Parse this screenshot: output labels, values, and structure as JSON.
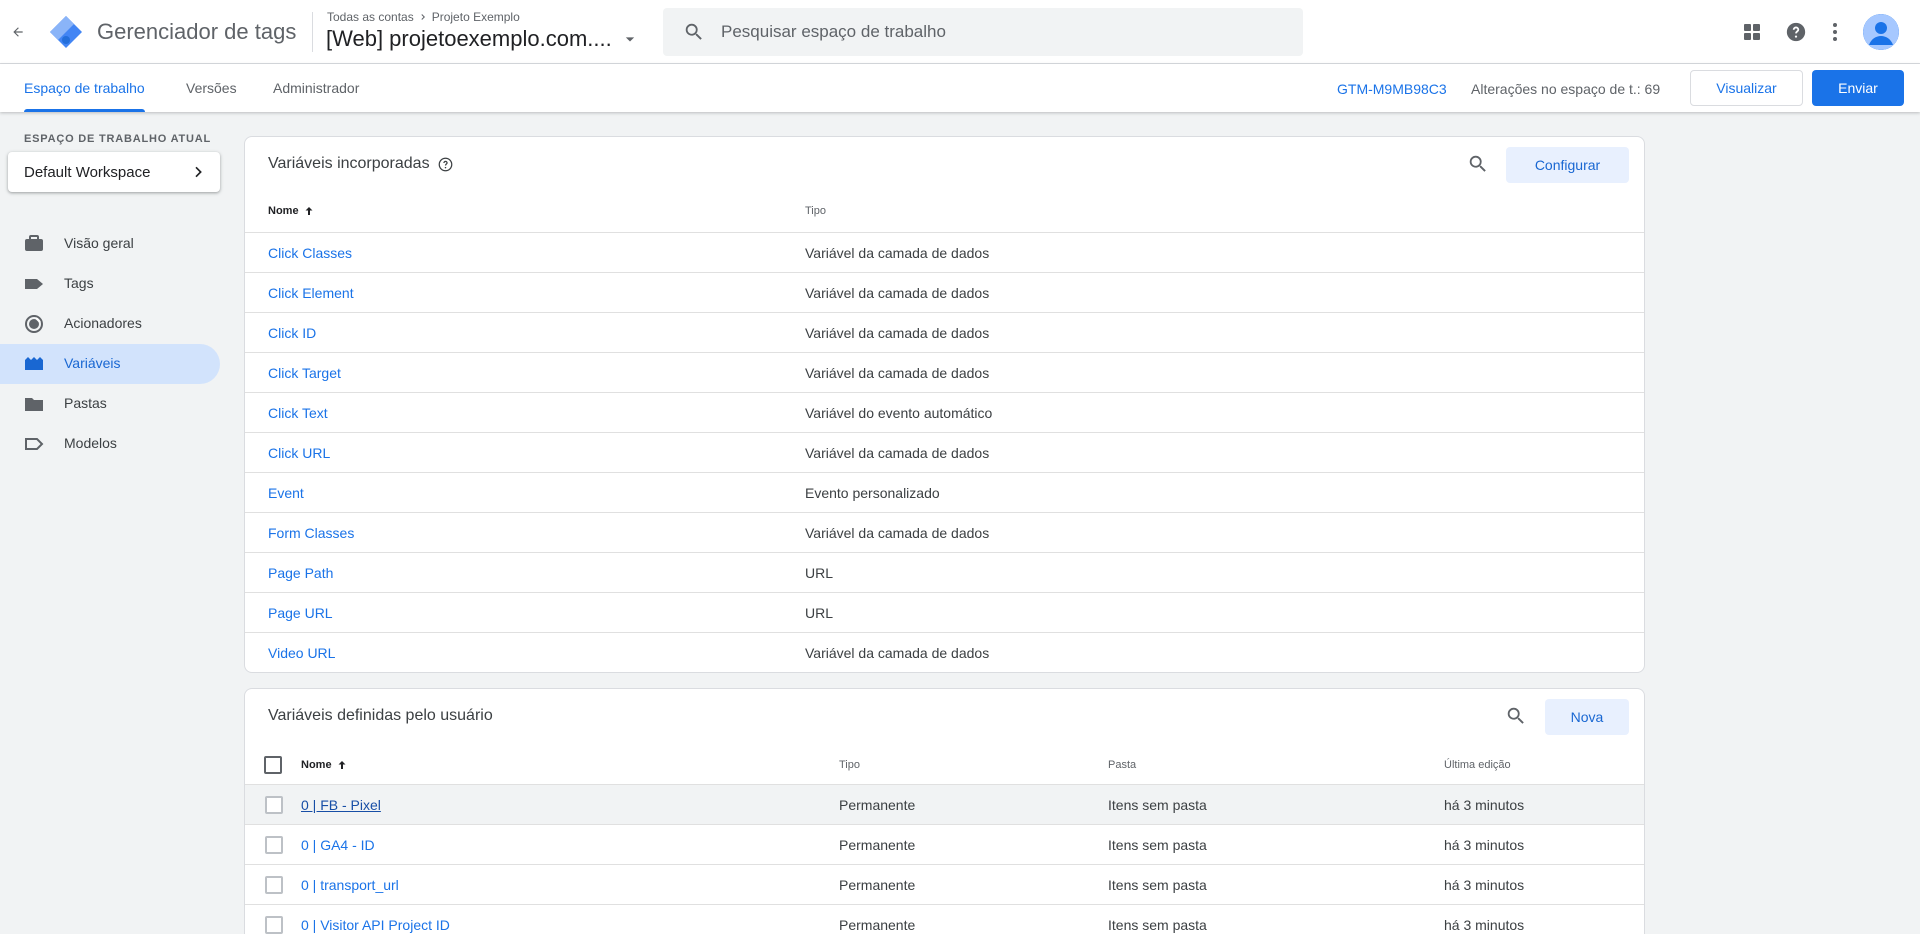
{
  "header": {
    "app_title": "Gerenciador de tags",
    "breadcrumb_account": "Todas as contas",
    "breadcrumb_project": "Projeto Exemplo",
    "container_name": "[Web] projetoexemplo.com....",
    "search_placeholder": "Pesquisar espaço de trabalho"
  },
  "subnav": {
    "tabs": [
      {
        "label": "Espaço de trabalho"
      },
      {
        "label": "Versões"
      },
      {
        "label": "Administrador"
      }
    ],
    "gtm_id": "GTM-M9MB98C3",
    "changes_label": "Alterações no espaço de t.: 69",
    "preview_label": "Visualizar",
    "submit_label": "Enviar"
  },
  "sidebar": {
    "workspace_label": "ESPAÇO DE TRABALHO ATUAL",
    "workspace_name": "Default Workspace",
    "items": [
      {
        "label": "Visão geral",
        "icon": "briefcase-icon"
      },
      {
        "label": "Tags",
        "icon": "tag-icon"
      },
      {
        "label": "Acionadores",
        "icon": "trigger-icon"
      },
      {
        "label": "Variáveis",
        "icon": "variables-icon"
      },
      {
        "label": "Pastas",
        "icon": "folder-icon"
      },
      {
        "label": "Modelos",
        "icon": "template-icon"
      }
    ]
  },
  "builtin": {
    "title": "Variáveis incorporadas",
    "configure_label": "Configurar",
    "col_name": "Nome",
    "col_type": "Tipo",
    "rows": [
      {
        "name": "Click Classes",
        "type": "Variável da camada de dados"
      },
      {
        "name": "Click Element",
        "type": "Variável da camada de dados"
      },
      {
        "name": "Click ID",
        "type": "Variável da camada de dados"
      },
      {
        "name": "Click Target",
        "type": "Variável da camada de dados"
      },
      {
        "name": "Click Text",
        "type": "Variável do evento automático"
      },
      {
        "name": "Click URL",
        "type": "Variável da camada de dados"
      },
      {
        "name": "Event",
        "type": "Evento personalizado"
      },
      {
        "name": "Form Classes",
        "type": "Variável da camada de dados"
      },
      {
        "name": "Page Path",
        "type": "URL"
      },
      {
        "name": "Page URL",
        "type": "URL"
      },
      {
        "name": "Video URL",
        "type": "Variável da camada de dados"
      }
    ]
  },
  "user_defined": {
    "title": "Variáveis definidas pelo usuário",
    "new_label": "Nova",
    "col_name": "Nome",
    "col_type": "Tipo",
    "col_folder": "Pasta",
    "col_edited": "Última edição",
    "rows": [
      {
        "name": "0 | FB - Pixel",
        "type": "Permanente",
        "folder": "Itens sem pasta",
        "edited": "há 3 minutos"
      },
      {
        "name": "0 | GA4 - ID",
        "type": "Permanente",
        "folder": "Itens sem pasta",
        "edited": "há 3 minutos"
      },
      {
        "name": "0 | transport_url",
        "type": "Permanente",
        "folder": "Itens sem pasta",
        "edited": "há 3 minutos"
      },
      {
        "name": "0 | Visitor API Project ID",
        "type": "Permanente",
        "folder": "Itens sem pasta",
        "edited": "há 3 minutos"
      }
    ]
  },
  "colors": {
    "accent": "#1a73e8",
    "active_nav_bg": "#d2e3fc",
    "background": "#f1f3f4"
  }
}
